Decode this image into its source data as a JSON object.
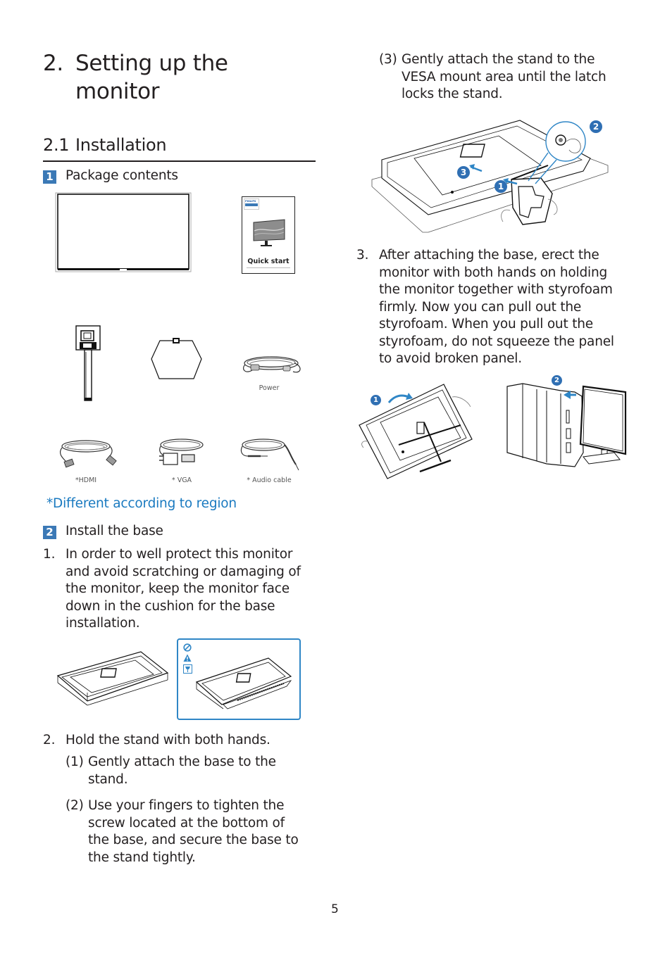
{
  "chapter": {
    "number": "2.",
    "title": "Setting up the monitor"
  },
  "section": {
    "number": "2.1",
    "title": "Installation"
  },
  "package_contents": {
    "badge": "1",
    "heading": "Package contents",
    "quick_start_label": "Quick start",
    "quick_start_brand": "PHILIPS",
    "items": [
      {
        "name": "monitor",
        "caption": ""
      },
      {
        "name": "quick-start-guide",
        "caption": ""
      },
      {
        "name": "stand",
        "caption": ""
      },
      {
        "name": "base",
        "caption": ""
      },
      {
        "name": "power-cable",
        "caption": "Power"
      },
      {
        "name": "hdmi-cable",
        "caption": "*HDMI"
      },
      {
        "name": "vga-cable",
        "caption": "* VGA"
      },
      {
        "name": "audio-cable",
        "caption": "* Audio cable"
      }
    ],
    "region_note": "*Different according to region"
  },
  "install_base": {
    "badge": "2",
    "heading": "Install the base",
    "steps": [
      {
        "number": "1.",
        "text": "In order to well protect this monitor and avoid scratching or damaging of the monitor, keep the monitor face down in the cushion for the base installation."
      },
      {
        "number": "2.",
        "text": "Hold the stand with both hands.",
        "substeps": [
          {
            "number": "(1)",
            "text": "Gently attach the base to the stand."
          },
          {
            "number": "(2)",
            "text": "Use your fingers to tighten the screw located at the bottom of the base, and secure the base to the stand tightly."
          },
          {
            "number": "(3)",
            "text": "Gently attach the stand to the VESA mount area until the latch locks the stand."
          }
        ]
      },
      {
        "number": "3.",
        "text": "After attaching the base, erect the monitor with both hands on holding the monitor together with styrofoam firmly. Now you can pull out the styrofoam. When you pull out the styrofoam, do not squeeze the panel to avoid broken panel."
      }
    ],
    "diagram_markers": {
      "attach": [
        "1",
        "2",
        "3"
      ],
      "erect": [
        "1",
        "2"
      ]
    }
  },
  "colors": {
    "accent": "#3b79b6",
    "note_blue": "#1a7ac0",
    "warn_border": "#2f86c6",
    "text": "#231f20"
  },
  "page_number": "5"
}
